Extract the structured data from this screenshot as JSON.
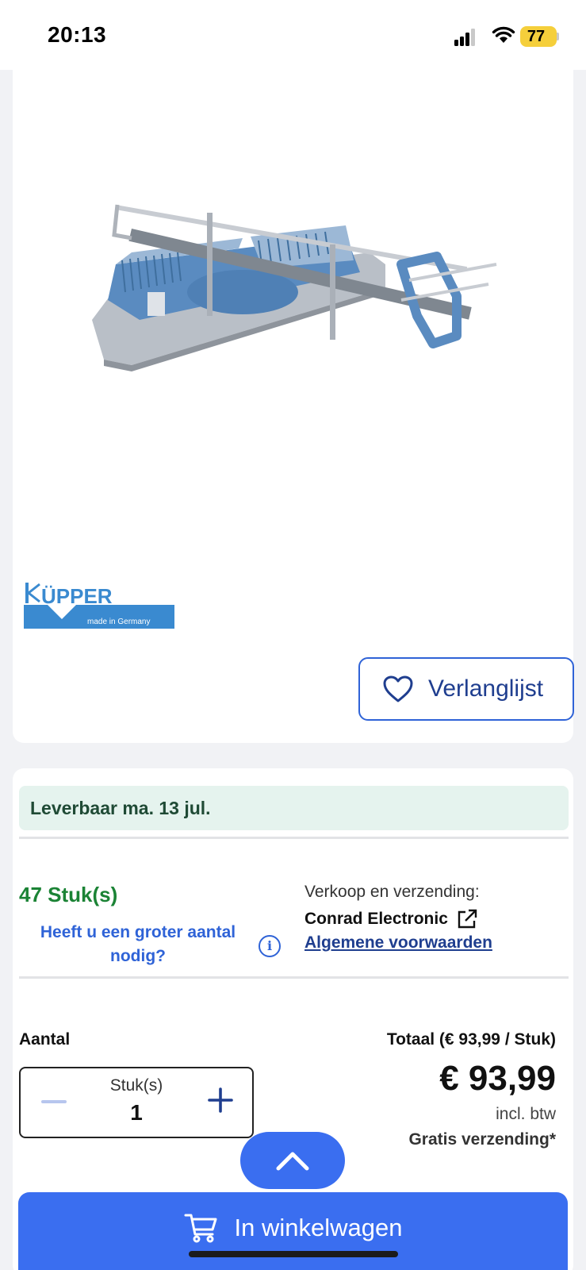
{
  "status_bar": {
    "time": "20:13",
    "battery": "77"
  },
  "product": {
    "image_icon": "mitre-saw-image",
    "brand_logo": {
      "name": "KÜPPER",
      "tagline": "made in Germany"
    },
    "wishlist_label": "Verlanglijst"
  },
  "availability": {
    "delivery": "Leverbaar ma. 13 jul.",
    "stock": "47 Stuk(s)",
    "bulk_line1": "Heeft u een groter aantal",
    "bulk_line2": "nodig?"
  },
  "seller": {
    "label": "Verkoop en verzending:",
    "name": "Conrad Electronic",
    "terms": "Algemene voorwaarden"
  },
  "order": {
    "qty_label": "Aantal",
    "total_label": "Totaal (€ 93,99 / Stuk)",
    "unit": "Stuk(s)",
    "quantity": "1",
    "price": "€ 93,99",
    "vat": "incl. btw",
    "shipping": "Gratis verzending*"
  },
  "cart": {
    "label": "In winkelwagen"
  },
  "colors": {
    "accent": "#3a6ef0",
    "link": "#2f63d7",
    "stock_green": "#1b8335",
    "delivery_bg": "#e5f3ee"
  }
}
